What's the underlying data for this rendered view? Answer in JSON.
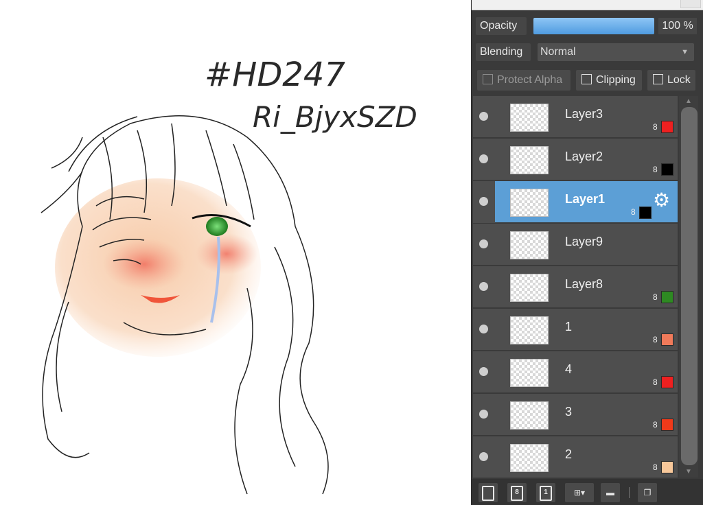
{
  "canvas": {
    "handwriting_line1": "#HD247",
    "handwriting_line2": "Ri_BjyxSZD"
  },
  "layer_panel": {
    "opacity_label": "Opacity",
    "opacity_value": "100 %",
    "opacity_fraction": 1.0,
    "blending_label": "Blending",
    "blending_value": "Normal",
    "protect_alpha_label": "Protect Alpha",
    "clipping_label": "Clipping",
    "lock_label": "Lock",
    "accent_color": "#5c9fd6",
    "layers": [
      {
        "name": "Layer3",
        "bit": "8",
        "color": "#ee2020",
        "selected": false
      },
      {
        "name": "Layer2",
        "bit": "8",
        "color": "#000000",
        "selected": false
      },
      {
        "name": "Layer1",
        "bit": "8",
        "color": "#000000",
        "selected": true
      },
      {
        "name": "Layer9",
        "bit": "",
        "color": "",
        "selected": false
      },
      {
        "name": "Layer8",
        "bit": "8",
        "color": "#2e8a22",
        "selected": false
      },
      {
        "name": "1",
        "bit": "8",
        "color": "#f07a5a",
        "selected": false
      },
      {
        "name": "4",
        "bit": "8",
        "color": "#ee2020",
        "selected": false
      },
      {
        "name": "3",
        "bit": "8",
        "color": "#f03a1a",
        "selected": false
      },
      {
        "name": "2",
        "bit": "8",
        "color": "#f8c89a",
        "selected": false
      }
    ],
    "toolbar_icons": [
      "new-layer-icon",
      "new-8bit-layer-icon",
      "new-1bit-layer-icon",
      "add-layer-dropdown-icon",
      "folder-icon",
      "duplicate-layer-icon"
    ],
    "toolbar_labels": {
      "eight": "8",
      "one": "1"
    }
  }
}
